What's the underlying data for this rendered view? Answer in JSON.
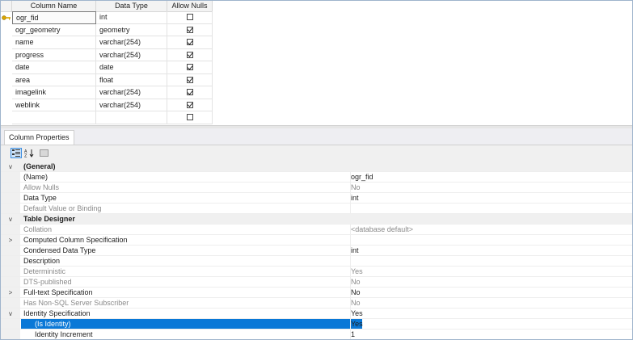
{
  "designer": {
    "headers": {
      "column_name": "Column Name",
      "data_type": "Data Type",
      "allow_nulls": "Allow Nulls"
    },
    "rows": [
      {
        "name": "ogr_fid",
        "type": "int",
        "allow_nulls": false,
        "is_key": true
      },
      {
        "name": "ogr_geometry",
        "type": "geometry",
        "allow_nulls": true
      },
      {
        "name": "name",
        "type": "varchar(254)",
        "allow_nulls": true
      },
      {
        "name": "progress",
        "type": "varchar(254)",
        "allow_nulls": true
      },
      {
        "name": "date",
        "type": "date",
        "allow_nulls": true
      },
      {
        "name": "area",
        "type": "float",
        "allow_nulls": true
      },
      {
        "name": "imagelink",
        "type": "varchar(254)",
        "allow_nulls": true
      },
      {
        "name": "weblink",
        "type": "varchar(254)",
        "allow_nulls": true
      },
      {
        "name": "",
        "type": "",
        "allow_nulls": false
      }
    ]
  },
  "properties": {
    "tab_label": "Column Properties",
    "toolbar": {
      "categorized_icon": "categorized-icon",
      "alphabetical_icon": "sort-az-icon",
      "pages_icon": "property-pages-icon"
    },
    "rows": [
      {
        "kind": "category",
        "expander": "v",
        "name": "(General)",
        "value": ""
      },
      {
        "kind": "prop",
        "name": "(Name)",
        "value": "ogr_fid"
      },
      {
        "kind": "prop",
        "dim": true,
        "name": "Allow Nulls",
        "value": "No"
      },
      {
        "kind": "prop",
        "name": "Data Type",
        "value": "int"
      },
      {
        "kind": "prop",
        "dim": true,
        "name": "Default Value or Binding",
        "value": ""
      },
      {
        "kind": "category",
        "expander": "v",
        "name": "Table Designer",
        "value": ""
      },
      {
        "kind": "prop",
        "dim": true,
        "name": "Collation",
        "value": "<database default>"
      },
      {
        "kind": "prop",
        "expander": ">",
        "name": "Computed Column Specification",
        "value": ""
      },
      {
        "kind": "prop",
        "name": "Condensed Data Type",
        "value": "int"
      },
      {
        "kind": "prop",
        "name": "Description",
        "value": ""
      },
      {
        "kind": "prop",
        "dim": true,
        "name": "Deterministic",
        "value": "Yes"
      },
      {
        "kind": "prop",
        "dim": true,
        "name": "DTS-published",
        "value": "No"
      },
      {
        "kind": "prop",
        "expander": ">",
        "name": "Full-text Specification",
        "value": "No"
      },
      {
        "kind": "prop",
        "dim": true,
        "name": "Has Non-SQL Server Subscriber",
        "value": "No"
      },
      {
        "kind": "prop",
        "expander": "v",
        "name": "Identity Specification",
        "value": "Yes"
      },
      {
        "kind": "selected",
        "name": "(Is Identity)",
        "value": "Yes"
      },
      {
        "kind": "sub",
        "name": "Identity Increment",
        "value": "1"
      }
    ]
  },
  "colors": {
    "selection": "#0a78d7",
    "category_bg": "#f0f0f0",
    "frame_border": "#9fb4cc"
  }
}
